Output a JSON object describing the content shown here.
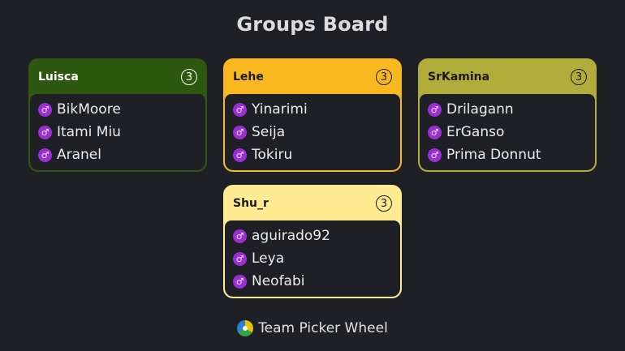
{
  "board": {
    "title": "Groups Board"
  },
  "groups": [
    {
      "name": "Luisca",
      "count": "3",
      "header_color": "#2e5810",
      "name_color": "#ffffff",
      "members": [
        "BikMoore",
        "Itami Miu",
        "Aranel"
      ]
    },
    {
      "name": "Lehe",
      "count": "3",
      "header_color": "#f9b81f",
      "name_color": "#1b1b1b",
      "members": [
        "Yinarimi",
        "Seija",
        "Tokiru"
      ]
    },
    {
      "name": "SrKamina",
      "count": "3",
      "header_color": "#b1ad3a",
      "name_color": "#1b1b1b",
      "members": [
        "Drilagann",
        "ErGanso",
        "Prima Donnut"
      ]
    },
    {
      "name": "Shu_r",
      "count": "3",
      "header_color": "#ffeb91",
      "name_color": "#1b1b1b",
      "members": [
        "aguirado92",
        "Leya",
        "Neofabi"
      ]
    }
  ],
  "icons": {
    "member": "male-gender-icon",
    "count": "count-circle-icon",
    "footer": "team-picker-wheel-logo-icon"
  },
  "footer": {
    "label": "Team Picker Wheel"
  }
}
